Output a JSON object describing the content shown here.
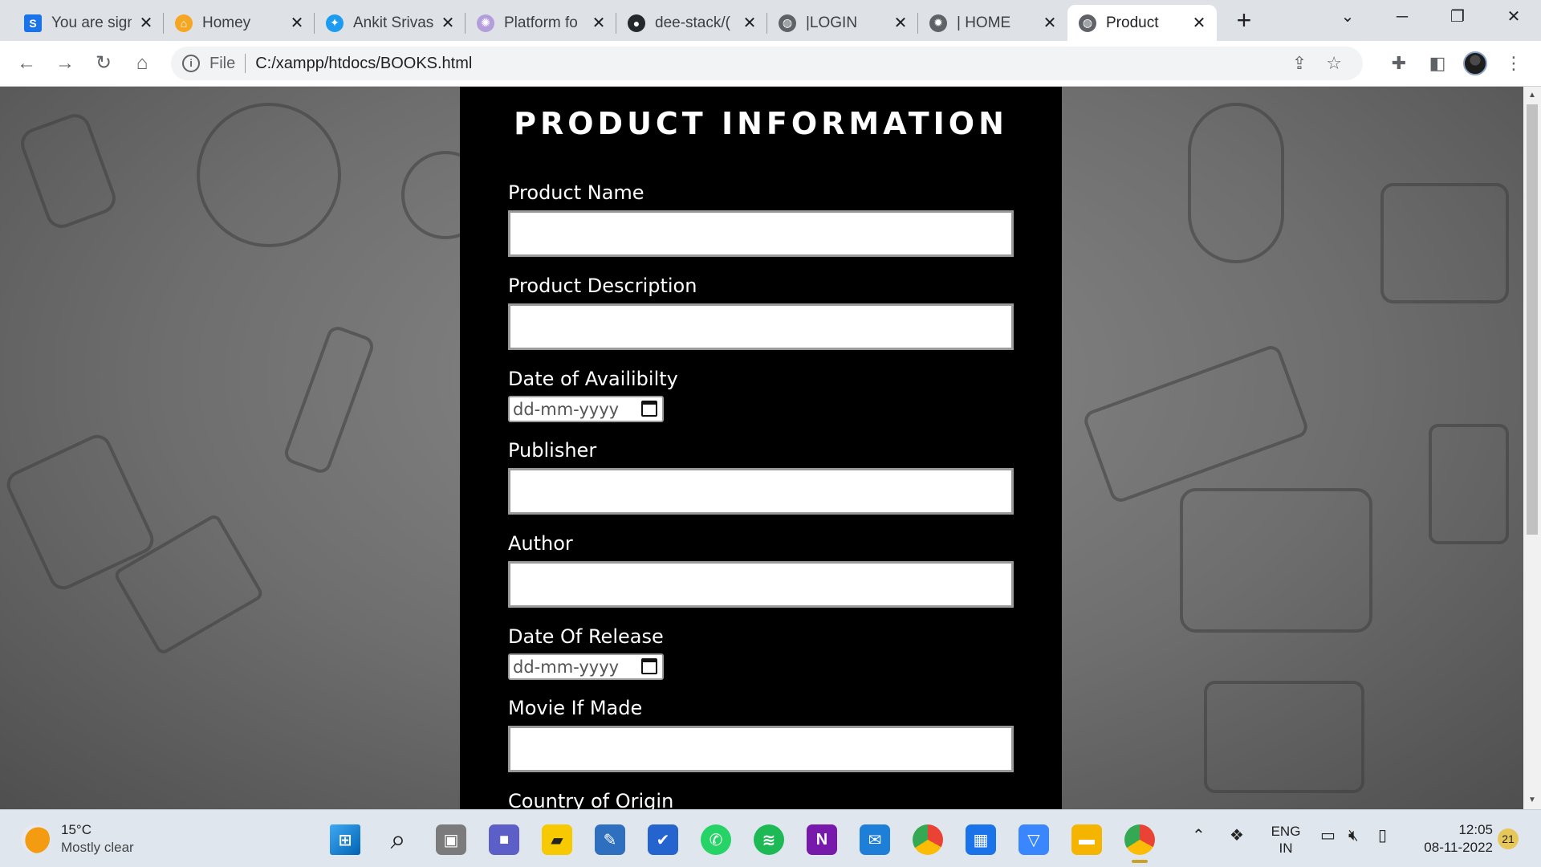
{
  "browser": {
    "tabs": [
      {
        "title": "You are sign",
        "favicon": "s-app-icon",
        "color": "#1a73e8"
      },
      {
        "title": "Homey",
        "favicon": "homey-icon",
        "color": "#f5a623"
      },
      {
        "title": "Ankit Srivas",
        "favicon": "twitter-icon",
        "color": "#1d9bf0"
      },
      {
        "title": "Platform fo",
        "favicon": "platform-icon",
        "color": "#b39ddb"
      },
      {
        "title": "dee-stack/(",
        "favicon": "github-icon",
        "color": "#24292e"
      },
      {
        "title": "|LOGIN",
        "favicon": "globe-icon",
        "color": "#5f6368"
      },
      {
        "title": "| HOME",
        "favicon": "gear-icon",
        "color": "#5f6368"
      },
      {
        "title": "Product",
        "favicon": "globe-icon",
        "color": "#5f6368"
      }
    ],
    "active_tab": 7,
    "address": {
      "chip": "File",
      "url": "C:/xampp/htdocs/BOOKS.html"
    }
  },
  "form": {
    "title": "PRODUCT INFORMATION",
    "fields": [
      {
        "label": "Product Name",
        "type": "text",
        "value": ""
      },
      {
        "label": "Product Description",
        "type": "text",
        "value": ""
      },
      {
        "label": "Date of Availibilty",
        "type": "date",
        "placeholder": "dd-mm-yyyy"
      },
      {
        "label": "Publisher",
        "type": "text",
        "value": ""
      },
      {
        "label": "Author",
        "type": "text",
        "value": ""
      },
      {
        "label": "Date Of Release",
        "type": "date",
        "placeholder": "dd-mm-yyyy"
      },
      {
        "label": "Movie If Made",
        "type": "text",
        "value": ""
      },
      {
        "label": "Country of Origin",
        "type": "text",
        "value": ""
      }
    ]
  },
  "taskbar": {
    "weather_temp": "15°C",
    "weather_desc": "Mostly clear",
    "lang_top": "ENG",
    "lang_bottom": "IN",
    "time": "12:05",
    "date": "08-11-2022",
    "notifications": "21",
    "apps": [
      "start-icon",
      "search-icon",
      "task-view-icon",
      "teams-icon",
      "sticky-notes-icon",
      "whiteboard-icon",
      "todo-icon",
      "whatsapp-icon",
      "spotify-icon",
      "onenote-icon",
      "mail-icon",
      "chrome-icon",
      "calendar-icon",
      "vpn-icon",
      "file-explorer-icon",
      "chrome-active-icon"
    ]
  },
  "colors": {
    "panel": "#000000",
    "accent": "#1a73e8"
  }
}
